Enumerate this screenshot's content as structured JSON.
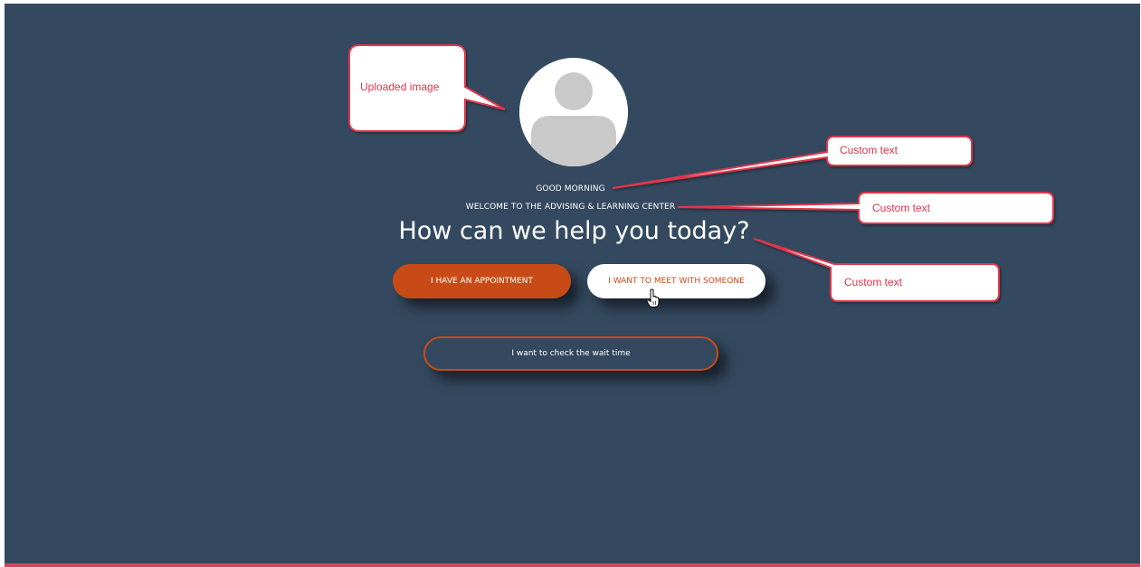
{
  "greeting": {
    "line1": "GOOD MORNING",
    "line2": "WELCOME TO THE ADVISING & LEARNING CENTER",
    "headline": "How can we help you today?"
  },
  "buttons": {
    "appointment": "I HAVE AN APPOINTMENT",
    "meet": "I WANT TO MEET WITH SOMEONE",
    "wait": "I want to check the wait time"
  },
  "callouts": {
    "uploaded_image": "Uploaded image",
    "custom_text_1": "Custom text",
    "custom_text_2": "Custom text",
    "custom_text_3": "Custom text"
  },
  "icons": {
    "avatar": "user-placeholder-icon",
    "cursor": "hand-pointer-icon"
  },
  "colors": {
    "background": "#34495f",
    "accent": "#c84b17",
    "annotation": "#e0344b",
    "bottom_bar": "#d2455c"
  }
}
